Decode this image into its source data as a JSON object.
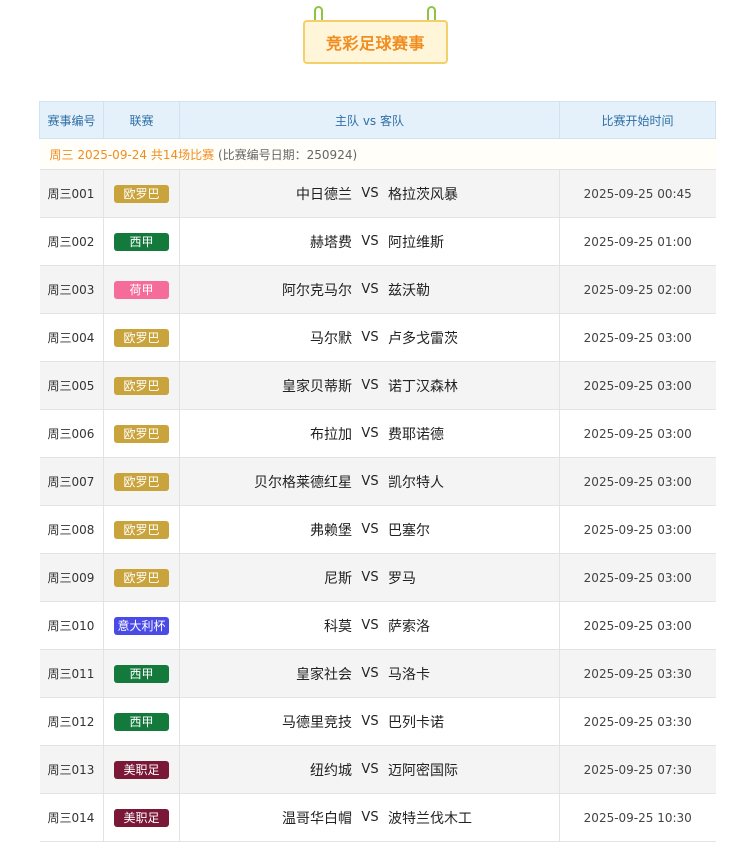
{
  "title": "竞彩足球赛事",
  "colors": {
    "europa": "#c9a33b",
    "laliga": "#137a3c",
    "eredivisie": "#f56b9a",
    "seriea_cup": "#4a4ae6",
    "mls": "#7a1838"
  },
  "headers": {
    "no": "赛事编号",
    "league": "联赛",
    "teams": "主队 vs 客队",
    "time": "比赛开始时间"
  },
  "date_info": {
    "main": "周三 2025-09-24 共14场比赛",
    "sub": "(比赛编号日期：250924)"
  },
  "vs_label": "VS",
  "matches": [
    {
      "no": "周三001",
      "league": "欧罗巴",
      "color": "#c9a33b",
      "home": "中日德兰",
      "away": "格拉茨风暴",
      "time": "2025-09-25 00:45"
    },
    {
      "no": "周三002",
      "league": "西甲",
      "color": "#137a3c",
      "home": "赫塔费",
      "away": "阿拉维斯",
      "time": "2025-09-25 01:00"
    },
    {
      "no": "周三003",
      "league": "荷甲",
      "color": "#f56b9a",
      "home": "阿尔克马尔",
      "away": "兹沃勒",
      "time": "2025-09-25 02:00"
    },
    {
      "no": "周三004",
      "league": "欧罗巴",
      "color": "#c9a33b",
      "home": "马尔默",
      "away": "卢多戈雷茨",
      "time": "2025-09-25 03:00"
    },
    {
      "no": "周三005",
      "league": "欧罗巴",
      "color": "#c9a33b",
      "home": "皇家贝蒂斯",
      "away": "诺丁汉森林",
      "time": "2025-09-25 03:00"
    },
    {
      "no": "周三006",
      "league": "欧罗巴",
      "color": "#c9a33b",
      "home": "布拉加",
      "away": "费耶诺德",
      "time": "2025-09-25 03:00"
    },
    {
      "no": "周三007",
      "league": "欧罗巴",
      "color": "#c9a33b",
      "home": "贝尔格莱德红星",
      "away": "凯尔特人",
      "time": "2025-09-25 03:00"
    },
    {
      "no": "周三008",
      "league": "欧罗巴",
      "color": "#c9a33b",
      "home": "弗赖堡",
      "away": "巴塞尔",
      "time": "2025-09-25 03:00"
    },
    {
      "no": "周三009",
      "league": "欧罗巴",
      "color": "#c9a33b",
      "home": "尼斯",
      "away": "罗马",
      "time": "2025-09-25 03:00"
    },
    {
      "no": "周三010",
      "league": "意大利杯",
      "color": "#4a4ae6",
      "home": "科莫",
      "away": "萨索洛",
      "time": "2025-09-25 03:00"
    },
    {
      "no": "周三011",
      "league": "西甲",
      "color": "#137a3c",
      "home": "皇家社会",
      "away": "马洛卡",
      "time": "2025-09-25 03:30"
    },
    {
      "no": "周三012",
      "league": "西甲",
      "color": "#137a3c",
      "home": "马德里竞技",
      "away": "巴列卡诺",
      "time": "2025-09-25 03:30"
    },
    {
      "no": "周三013",
      "league": "美职足",
      "color": "#7a1838",
      "home": "纽约城",
      "away": "迈阿密国际",
      "time": "2025-09-25 07:30"
    },
    {
      "no": "周三014",
      "league": "美职足",
      "color": "#7a1838",
      "home": "温哥华白帽",
      "away": "波特兰伐木工",
      "time": "2025-09-25 10:30"
    }
  ]
}
